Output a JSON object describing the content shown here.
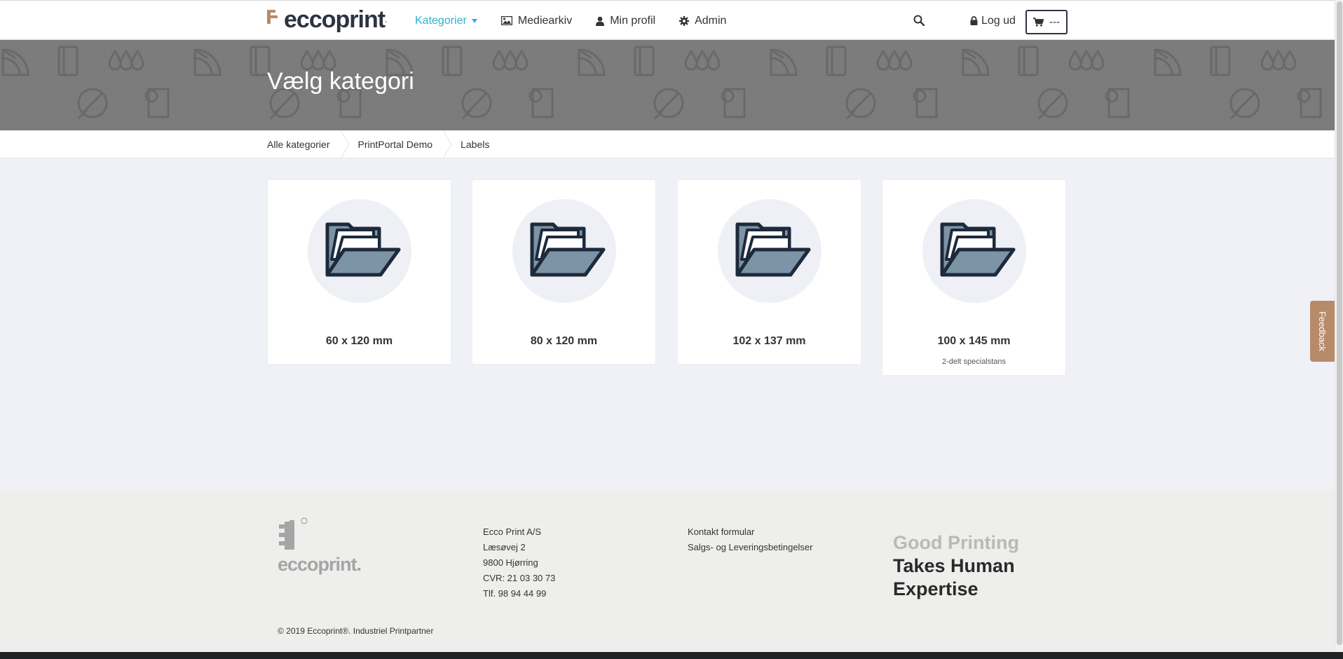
{
  "brand": {
    "name": "eccoprint",
    "reg_mark": "®",
    "accent": "#b78b6a",
    "dark": "#2c3442",
    "link": "#2bb3c9"
  },
  "nav": {
    "items": [
      {
        "label": "Kategorier",
        "icon": "caret-down-icon",
        "active": true
      },
      {
        "label": "Mediearkiv",
        "icon": "image-icon"
      },
      {
        "label": "Min profil",
        "icon": "user-icon"
      },
      {
        "label": "Admin",
        "icon": "gear-icon"
      }
    ],
    "search_icon": "search-icon",
    "logout_label": "Log ud",
    "cart_label": "---"
  },
  "hero": {
    "title": "Vælg kategori"
  },
  "breadcrumb": [
    "Alle kategorier",
    "PrintPortal Demo",
    "Labels"
  ],
  "categories": [
    {
      "title": "60 x 120 mm",
      "subtitle": ""
    },
    {
      "title": "80 x 120 mm",
      "subtitle": ""
    },
    {
      "title": "102 x 137 mm",
      "subtitle": ""
    },
    {
      "title": "100 x 145 mm",
      "subtitle": "2-delt specialstans"
    }
  ],
  "feedback_label": "Feedback",
  "footer": {
    "logo_text": "eccoprint.",
    "address": [
      "Ecco Print A/S",
      "Læsøvej 2",
      "9800 Hjørring",
      "CVR: 21 03 30 73",
      "Tlf. 98 94 44 99"
    ],
    "links": [
      "Kontakt formular",
      "Salgs- og Leveringsbetingelser"
    ],
    "tagline": [
      "Good Printing",
      "Takes Human",
      "Expertise"
    ],
    "copyright": "© 2019 Eccoprint®. Industriel Printpartner"
  }
}
